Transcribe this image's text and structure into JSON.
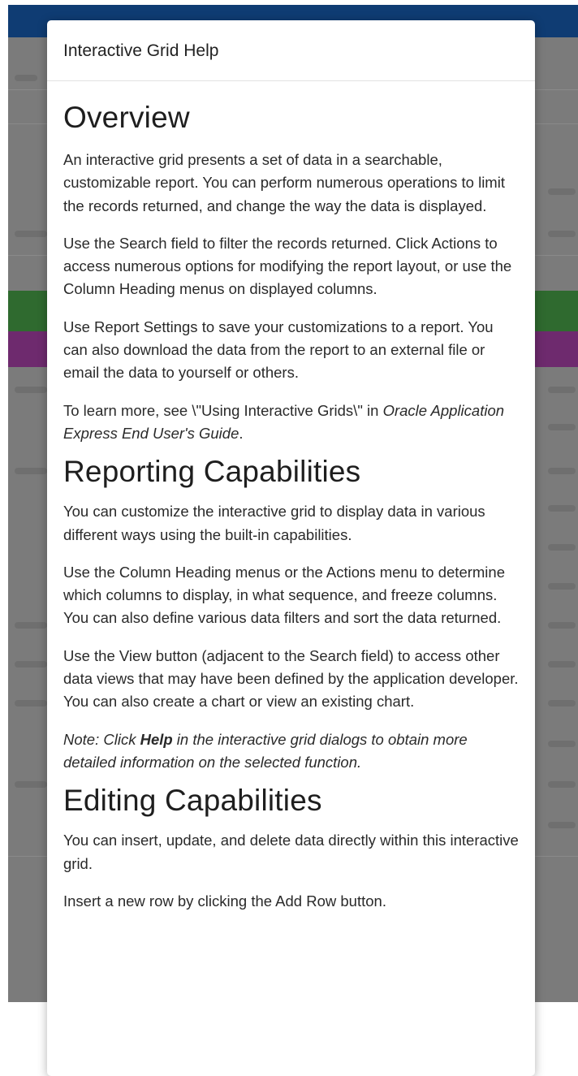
{
  "dialog": {
    "title": "Interactive Grid Help"
  },
  "overview": {
    "heading": "Overview",
    "p1": "An interactive grid presents a set of data in a searchable, customizable report. You can perform numerous operations to limit the records returned, and change the way the data is displayed.",
    "p2": "Use the Search field to filter the records returned. Click Actions to access numerous options for modifying the report layout, or use the Column Heading menus on displayed columns.",
    "p3": "Use Report Settings to save your customizations to a report. You can also download the data from the report to an external file or email the data to yourself or others.",
    "p4_prefix": "To learn more, see \\\"Using Interactive Grids\\\" in ",
    "p4_guide": "Oracle Application Express End User's Guide",
    "p4_suffix": "."
  },
  "reporting": {
    "heading": "Reporting Capabilities",
    "p1": "You can customize the interactive grid to display data in various different ways using the built-in capabilities.",
    "p2": "Use the Column Heading menus or the Actions menu to determine which columns to display, in what sequence, and freeze columns. You can also define various data filters and sort the data returned.",
    "p3": "Use the View button (adjacent to the Search field) to access other data views that may have been defined by the application developer. You can also create a chart or view an existing chart.",
    "note_prefix": "Note: Click ",
    "note_bold": "Help",
    "note_suffix": " in the interactive grid dialogs to obtain more detailed information on the selected function."
  },
  "editing": {
    "heading": "Editing Capabilities",
    "p1": "You can insert, update, and delete data directly within this interactive grid.",
    "p2": "Insert a new row by clicking the Add Row button."
  },
  "colors": {
    "header_bar": "#0f3c73",
    "overlay": "#7b7b7b",
    "row_green": "#2f6a2f",
    "row_purple": "#6e2a6e"
  }
}
